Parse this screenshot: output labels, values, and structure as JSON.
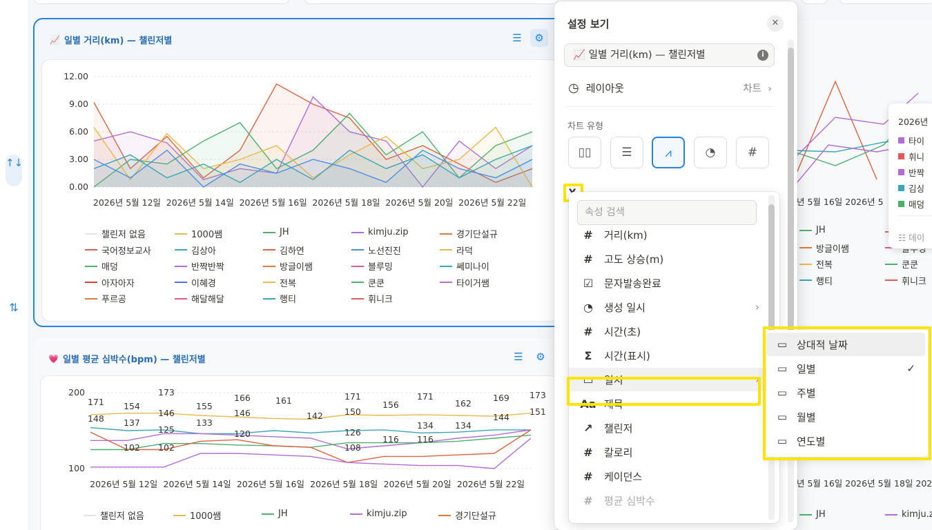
{
  "rail": {
    "up_down": "↑↓",
    "move": "⇅"
  },
  "card1": {
    "title": "일별 거리(km) — 챌린저별",
    "y_ticks": [
      "12.00",
      "9.00",
      "6.00",
      "3.00",
      "0.00"
    ],
    "x_ticks": [
      "2026년 5월 12일",
      "2026년 5월 14일",
      "2026년 5월 16일",
      "2026년 5월 18일",
      "2026년 5월 20일",
      "2026년 5월 22일"
    ]
  },
  "card2": {
    "title": "일별 평균 심박수(bpm) — 챌린저별",
    "y_ticks": [
      "200",
      "100"
    ],
    "x_ticks": [
      "2026년 5월 12일",
      "2026년 5월 14일",
      "2026년 5월 16일",
      "2026년 5월 18일",
      "2026년 5월 20일",
      "2026년 5월 22일"
    ],
    "data_labels": [
      "171",
      "148",
      "154",
      "137",
      "173",
      "146",
      "125",
      "102",
      "102",
      "155",
      "133",
      "166",
      "146",
      "120",
      "161",
      "142",
      "171",
      "150",
      "126",
      "108",
      "156",
      "116",
      "171",
      "134",
      "116",
      "162",
      "134",
      "169",
      "144",
      "173",
      "151"
    ]
  },
  "legend": [
    {
      "name": "챌린저 없음",
      "color": "#e3e3e3"
    },
    {
      "name": "1000쌤",
      "color": "#e9b949"
    },
    {
      "name": "JH",
      "color": "#4caf6e"
    },
    {
      "name": "kimju.zip",
      "color": "#b36bd6"
    },
    {
      "name": "경기단설규",
      "color": "#e07a3a"
    },
    {
      "name": "국어정보교사",
      "color": "#e05a5a"
    },
    {
      "name": "김상아",
      "color": "#3aa6b5"
    },
    {
      "name": "김하연",
      "color": "#e06040"
    },
    {
      "name": "노선진진",
      "color": "#4a90e2"
    },
    {
      "name": "라덕",
      "color": "#e9b949"
    },
    {
      "name": "매덩",
      "color": "#4caf6e"
    },
    {
      "name": "반짝반짝",
      "color": "#b36bd6"
    },
    {
      "name": "방글이쌤",
      "color": "#e07a3a"
    },
    {
      "name": "블루밍",
      "color": "#e05a8a"
    },
    {
      "name": "쎄미나이",
      "color": "#3aa6b5"
    },
    {
      "name": "아자아자",
      "color": "#d9402f"
    },
    {
      "name": "이혜경",
      "color": "#4a70e2"
    },
    {
      "name": "전복",
      "color": "#e9b949"
    },
    {
      "name": "쿤쿤",
      "color": "#4caf6e"
    },
    {
      "name": "타이거쌤",
      "color": "#b36bd6"
    },
    {
      "name": "푸르공",
      "color": "#e07a3a"
    },
    {
      "name": "해달해달",
      "color": "#e05a8a"
    },
    {
      "name": "행티",
      "color": "#3aa6b5"
    },
    {
      "name": "휘니크",
      "color": "#e05a5a"
    }
  ],
  "chart_data": [
    {
      "type": "area",
      "title": "일별 거리(km) — 챌린저별",
      "x": [
        "2026-05-11",
        "2026-05-12",
        "2026-05-13",
        "2026-05-14",
        "2026-05-15",
        "2026-05-16",
        "2026-05-17",
        "2026-05-18",
        "2026-05-19",
        "2026-05-20",
        "2026-05-21",
        "2026-05-22",
        "2026-05-23"
      ],
      "ylim": [
        0,
        12
      ],
      "series": [
        {
          "name": "김하연",
          "values": [
            9.2,
            2.0,
            5.5,
            1.0,
            4.0,
            11.2,
            9.0,
            7.5,
            3.0,
            4.5,
            2.5,
            0.5,
            2.0
          ]
        },
        {
          "name": "kimju.zip",
          "values": [
            5.0,
            6.0,
            4.8,
            0.8,
            2.0,
            1.5,
            9.8,
            6.0,
            5.0,
            0.0,
            5.0,
            2.0,
            4.5
          ]
        },
        {
          "name": "JH",
          "values": [
            0.0,
            3.0,
            2.5,
            5.0,
            7.0,
            2.0,
            4.0,
            8.0,
            3.5,
            6.0,
            1.0,
            4.5,
            6.0
          ]
        },
        {
          "name": "1000쌤",
          "values": [
            6.5,
            0.8,
            5.8,
            2.0,
            3.0,
            4.5,
            1.0,
            3.5,
            5.5,
            2.0,
            3.0,
            6.5,
            0.0
          ]
        },
        {
          "name": "김상아",
          "values": [
            2.0,
            3.5,
            1.0,
            2.5,
            0.5,
            3.0,
            0.8,
            4.0,
            2.0,
            3.5,
            1.0,
            3.0,
            4.5
          ]
        },
        {
          "name": "노선진진",
          "values": [
            3.0,
            1.0,
            4.0,
            0.0,
            2.5,
            1.5,
            3.0,
            2.0,
            0.5,
            4.0,
            2.0,
            1.0,
            3.0
          ]
        }
      ]
    },
    {
      "type": "line",
      "title": "일별 평균 심박수(bpm) — 챌린저별",
      "x": [
        "2026-05-11",
        "2026-05-12",
        "2026-05-13",
        "2026-05-14",
        "2026-05-15",
        "2026-05-16",
        "2026-05-17",
        "2026-05-18",
        "2026-05-19",
        "2026-05-20",
        "2026-05-21",
        "2026-05-22",
        "2026-05-23"
      ],
      "ylim": [
        100,
        200
      ],
      "series": [
        {
          "name": "1000쌤",
          "values": [
            171,
            173,
            173,
            170,
            168,
            166,
            165,
            171,
            170,
            171,
            170,
            169,
            173
          ]
        },
        {
          "name": "김상아",
          "values": [
            154,
            150,
            151,
            146,
            146,
            150,
            147,
            150,
            151,
            147,
            148,
            151,
            151
          ]
        },
        {
          "name": "kimju.zip",
          "values": [
            137,
            137,
            146,
            146,
            144,
            142,
            140,
            126,
            130,
            134,
            140,
            144,
            151
          ]
        },
        {
          "name": "JH",
          "values": [
            125,
            125,
            133,
            133,
            131,
            130,
            128,
            134,
            134,
            134,
            136,
            140,
            144
          ]
        },
        {
          "name": "김하연",
          "values": [
            148,
            125,
            125,
            136,
            138,
            130,
            128,
            108,
            116,
            116,
            118,
            120,
            151
          ]
        },
        {
          "name": "반짝반짝",
          "values": [
            102,
            102,
            102,
            120,
            120,
            118,
            116,
            108,
            106,
            104,
            104,
            100,
            140
          ]
        }
      ]
    }
  ],
  "panel": {
    "title": "설정 보기",
    "close": "✕",
    "name_value": "일별 거리(km) — 챌린저별",
    "name_icon": "📈",
    "info": "i",
    "layout_label": "레이아웃",
    "layout_value": "차트",
    "chart_type_label": "차트 유형",
    "chart_types": [
      "▯▯",
      "☰",
      "⩘",
      "◔",
      "#"
    ],
    "y_axis_label": "Y축"
  },
  "prop_menu": {
    "search_placeholder": "속성 검색",
    "items": [
      {
        "icon": "#",
        "label": "거리(km)",
        "chev": ""
      },
      {
        "icon": "#",
        "label": "고도 상승(m)",
        "chev": ""
      },
      {
        "icon": "☑",
        "label": "문자발송완료",
        "chev": ""
      },
      {
        "icon": "◔",
        "label": "생성 일시",
        "chev": "›"
      },
      {
        "icon": "#",
        "label": "시간(초)",
        "chev": ""
      },
      {
        "icon": "Σ",
        "label": "시간(표시)",
        "chev": ""
      },
      {
        "icon": "▭",
        "label": "일시",
        "chev": "›"
      },
      {
        "icon": "Aa",
        "label": "제목",
        "chev": ""
      },
      {
        "icon": "↗",
        "label": "챌린저",
        "chev": ""
      },
      {
        "icon": "#",
        "label": "칼로리",
        "chev": ""
      },
      {
        "icon": "#",
        "label": "케이던스",
        "chev": ""
      },
      {
        "icon": "#",
        "label": "평균 심박수",
        "chev": ""
      }
    ]
  },
  "sub_menu": {
    "items": [
      {
        "label": "상대적 날짜",
        "check": ""
      },
      {
        "label": "일별",
        "check": "✓"
      },
      {
        "label": "주별",
        "check": ""
      },
      {
        "label": "월별",
        "check": ""
      },
      {
        "label": "연도별",
        "check": ""
      }
    ]
  },
  "right_peek": {
    "tooltip_date": "2026년",
    "tooltip_items": [
      {
        "label": "타이",
        "color": "#b36bd6"
      },
      {
        "label": "휘니",
        "color": "#e05a5a"
      },
      {
        "label": "반짝",
        "color": "#b36bd6"
      },
      {
        "label": "김싱",
        "color": "#3aa6b5"
      },
      {
        "label": "매덩",
        "color": "#4caf6e"
      }
    ],
    "tooltip_footer": "데이",
    "x_ticks": [
      "년 5월 16일 2026년 5"
    ],
    "x_ticks2": [
      "년 5월 16일 2026년 5월 18일 202"
    ],
    "legend_peek": [
      {
        "name": "JH",
        "color": "#4caf6e"
      },
      {
        "name": "김하연",
        "color": "#e06040"
      },
      {
        "name": "방글이쌤",
        "color": "#e07a3a"
      },
      {
        "name": "블루밍",
        "color": "#e05a8a"
      },
      {
        "name": "전복",
        "color": "#e9b949"
      },
      {
        "name": "쿤쿤",
        "color": "#4caf6e"
      },
      {
        "name": "행티",
        "color": "#3aa6b5"
      },
      {
        "name": "휘니크",
        "color": "#e05a5a"
      }
    ]
  }
}
